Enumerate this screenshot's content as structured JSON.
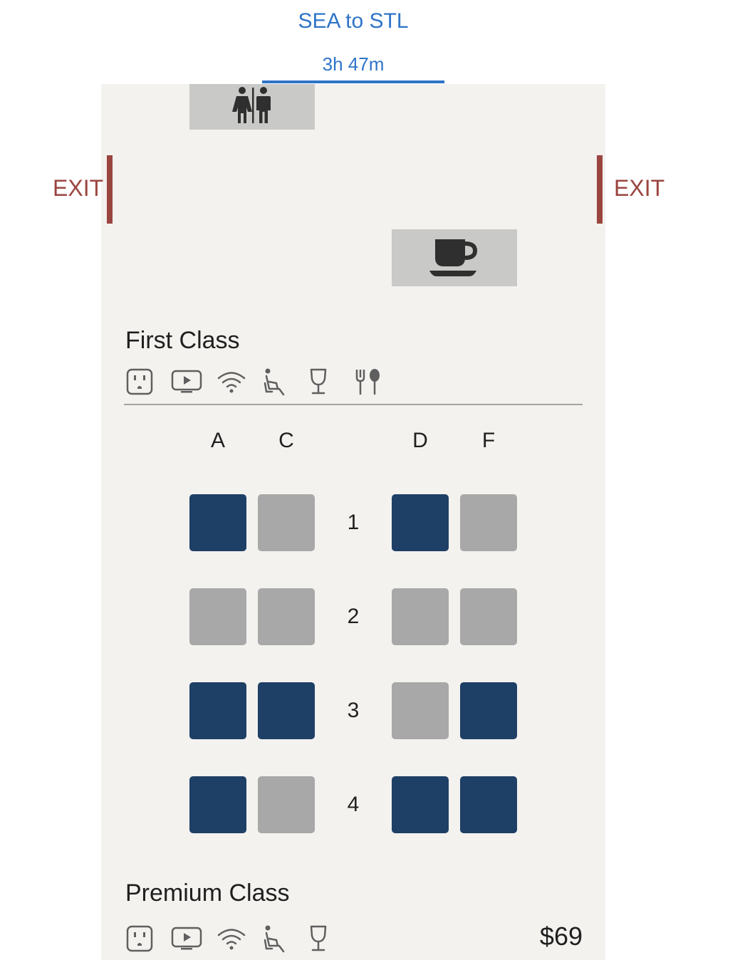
{
  "header": {
    "route": "SEA to STL",
    "duration": "3h 47m"
  },
  "facilities": {
    "lavatory_icon": "restroom-icon",
    "galley_icon": "coffee-cup-icon"
  },
  "exits": {
    "left": "EXIT",
    "right": "EXIT"
  },
  "colors": {
    "accent": "#2f74c8",
    "exit": "#9b4540",
    "seat_available": "#1e3f66",
    "seat_occupied": "#a8a8a8",
    "cabin_bg": "#f3f2ef"
  },
  "first_class": {
    "title": "First Class",
    "amenities": [
      "power-outlet-icon",
      "entertainment-icon",
      "wifi-icon",
      "recline-seat-icon",
      "wine-glass-icon",
      "dining-icon"
    ],
    "columns": [
      "A",
      "C",
      "D",
      "F"
    ],
    "rows": [
      {
        "number": "1",
        "seats": [
          "available",
          "occupied",
          "available",
          "occupied"
        ]
      },
      {
        "number": "2",
        "seats": [
          "occupied",
          "occupied",
          "occupied",
          "occupied"
        ]
      },
      {
        "number": "3",
        "seats": [
          "available",
          "available",
          "occupied",
          "available"
        ]
      },
      {
        "number": "4",
        "seats": [
          "available",
          "occupied",
          "available",
          "available"
        ]
      }
    ]
  },
  "premium_class": {
    "title": "Premium Class",
    "amenities": [
      "power-outlet-icon",
      "entertainment-icon",
      "wifi-icon",
      "recline-seat-icon",
      "wine-glass-icon"
    ],
    "price": "$69"
  }
}
